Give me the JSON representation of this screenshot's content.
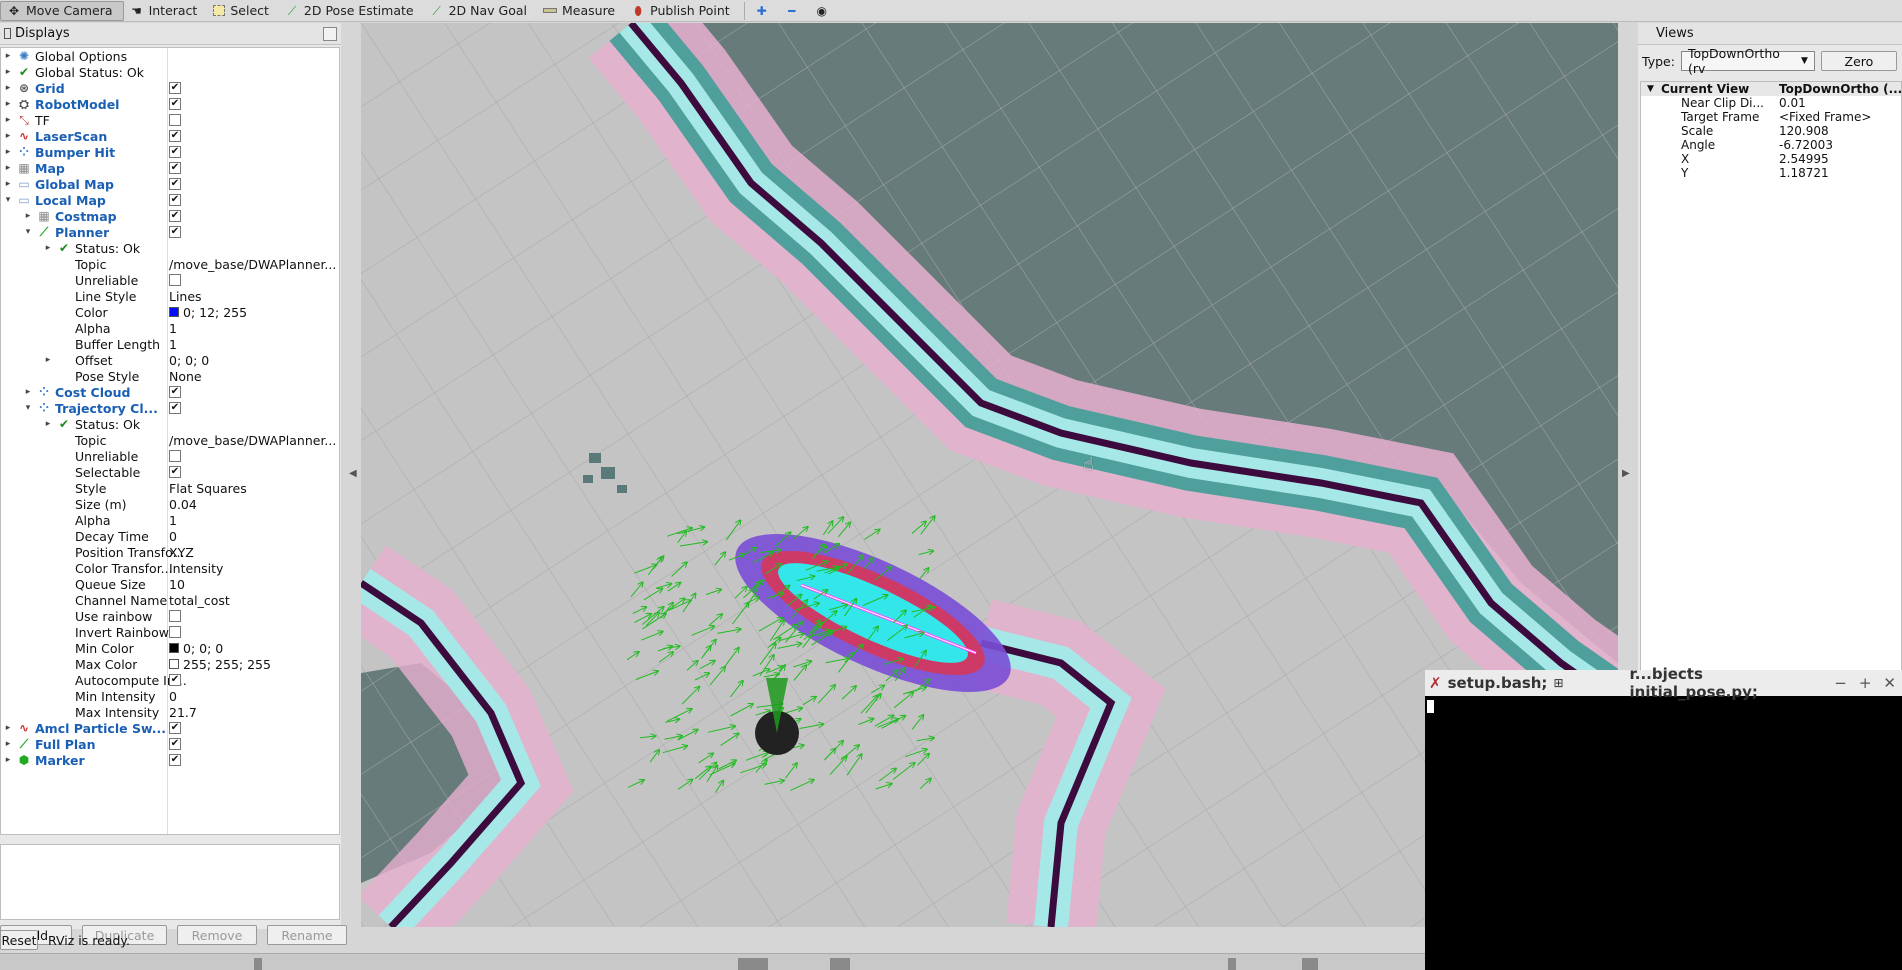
{
  "toolbar": {
    "tools": [
      {
        "label": "Move Camera",
        "icon": "move-camera-icon"
      },
      {
        "label": "Interact",
        "icon": "hand-icon"
      },
      {
        "label": "Select",
        "icon": "select-icon"
      },
      {
        "label": "2D Pose Estimate",
        "icon": "pose-arrow-icon"
      },
      {
        "label": "2D Nav Goal",
        "icon": "goal-arrow-icon"
      },
      {
        "label": "Measure",
        "icon": "ruler-icon"
      },
      {
        "label": "Publish Point",
        "icon": "map-pin-icon"
      }
    ]
  },
  "displays": {
    "title": "Displays",
    "items": [
      {
        "name": "Global Options",
        "value": ""
      },
      {
        "name": "Global Status: Ok",
        "value": ""
      },
      {
        "name": "Grid",
        "value": ""
      },
      {
        "name": "RobotModel",
        "value": ""
      },
      {
        "name": "TF",
        "value": ""
      },
      {
        "name": "LaserScan",
        "value": ""
      },
      {
        "name": "Bumper Hit",
        "value": ""
      },
      {
        "name": "Map",
        "value": ""
      },
      {
        "name": "Global Map",
        "value": ""
      },
      {
        "name": "Local Map",
        "value": ""
      },
      {
        "name": "Costmap",
        "value": ""
      },
      {
        "name": "Planner",
        "value": ""
      },
      {
        "name": "Status: Ok",
        "value": ""
      },
      {
        "name": "Topic",
        "value": "/move_base/DWAPlanner..."
      },
      {
        "name": "Unreliable",
        "value": ""
      },
      {
        "name": "Line Style",
        "value": "Lines"
      },
      {
        "name": "Color",
        "value": "0; 12; 255"
      },
      {
        "name": "Alpha",
        "value": "1"
      },
      {
        "name": "Buffer Length",
        "value": "1"
      },
      {
        "name": "Offset",
        "value": "0; 0; 0"
      },
      {
        "name": "Pose Style",
        "value": "None"
      },
      {
        "name": "Cost Cloud",
        "value": ""
      },
      {
        "name": "Trajectory Cl...",
        "value": ""
      },
      {
        "name": "Status: Ok",
        "value": ""
      },
      {
        "name": "Topic",
        "value": "/move_base/DWAPlanner..."
      },
      {
        "name": "Unreliable",
        "value": ""
      },
      {
        "name": "Selectable",
        "value": ""
      },
      {
        "name": "Style",
        "value": "Flat Squares"
      },
      {
        "name": "Size (m)",
        "value": "0.04"
      },
      {
        "name": "Alpha",
        "value": "1"
      },
      {
        "name": "Decay Time",
        "value": "0"
      },
      {
        "name": "Position Transfo...",
        "value": "XYZ"
      },
      {
        "name": "Color Transfor...",
        "value": "Intensity"
      },
      {
        "name": "Queue Size",
        "value": "10"
      },
      {
        "name": "Channel Name",
        "value": "total_cost"
      },
      {
        "name": "Use rainbow",
        "value": ""
      },
      {
        "name": "Invert Rainbow",
        "value": ""
      },
      {
        "name": "Min Color",
        "value": "0; 0; 0"
      },
      {
        "name": "Max Color",
        "value": "255; 255; 255"
      },
      {
        "name": "Autocompute In...",
        "value": ""
      },
      {
        "name": "Min Intensity",
        "value": "0"
      },
      {
        "name": "Max Intensity",
        "value": "21.7"
      },
      {
        "name": "Amcl Particle Sw...",
        "value": ""
      },
      {
        "name": "Full Plan",
        "value": ""
      },
      {
        "name": "Marker",
        "value": ""
      }
    ],
    "buttons": {
      "add": "Add",
      "duplicate": "Duplicate",
      "remove": "Remove",
      "rename": "Rename"
    }
  },
  "views": {
    "title": "Views",
    "type_label": "Type:",
    "type_value": "TopDownOrtho (rv",
    "zero_button": "Zero",
    "current_view": {
      "name": "Current View",
      "value": "TopDownOrtho (..."
    },
    "props": [
      {
        "name": "Near Clip Di...",
        "value": "0.01"
      },
      {
        "name": "Target Frame",
        "value": "<Fixed Frame>"
      },
      {
        "name": "Scale",
        "value": "120.908"
      },
      {
        "name": "Angle",
        "value": "-6.72003"
      },
      {
        "name": "X",
        "value": "2.54995"
      },
      {
        "name": "Y",
        "value": "1.18721"
      }
    ]
  },
  "terminal": {
    "tab1": "setup.bash;",
    "tab2": "r...bjects initial_pose.py;",
    "controls": [
      "−",
      "+",
      "✕"
    ]
  },
  "status": {
    "reset": "Reset",
    "message": "RViz is ready."
  },
  "colors": {
    "map_unknown": "#677b7b",
    "map_free": "#c4c4c4",
    "obstacle": "#3c0a3c",
    "inflation_cyan": "#a6e8e8",
    "inflation_teal": "#4f9f9c",
    "inflation_pink": "#e2a7c6",
    "planner_color": "#000cff",
    "particles": "#22bb22",
    "robot": "#222222"
  }
}
